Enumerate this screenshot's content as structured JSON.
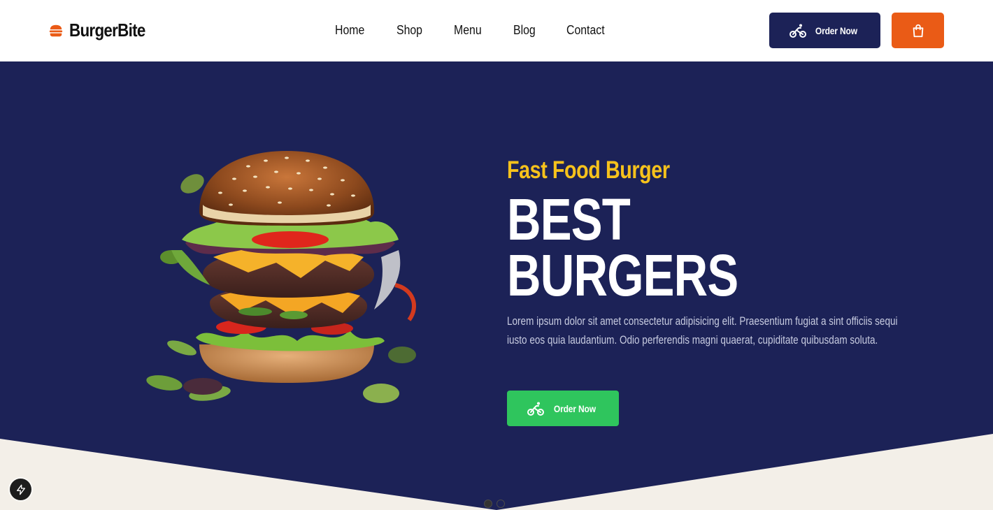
{
  "brand": {
    "name": "BurgerBite",
    "icon": "burger-icon",
    "accent": "#ea5b16"
  },
  "nav": {
    "links": [
      "Home",
      "Shop",
      "Menu",
      "Blog",
      "Contact"
    ]
  },
  "header_actions": {
    "order_label": "Order Now",
    "order_icon": "bicycle-icon",
    "cart_icon": "shopping-bag-icon",
    "order_color": "#1c2257",
    "cart_color": "#ea5b16"
  },
  "hero": {
    "subtitle": "Fast Food Burger",
    "title_line1": "BEST",
    "title_line2": "BURGERS",
    "description": "Lorem ipsum dolor sit amet consectetur adipisicing elit. Praesentium fugiat a sint officiis sequi iusto eos quia laudantium. Odio perferendis magni quaerat, cupiditate quibusdam soluta.",
    "cta_label": "Order Now",
    "cta_color": "#2fc55d",
    "background": "#1c2257",
    "subtitle_color": "#f6c21c"
  },
  "carousel": {
    "slides": 2,
    "active": 1
  },
  "dev_badge": {
    "icon": "lightning-bolt-icon"
  }
}
